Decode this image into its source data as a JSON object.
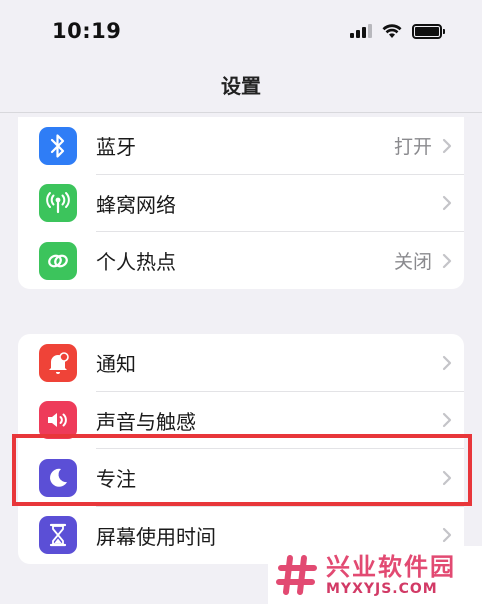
{
  "status_bar": {
    "time": "10:19"
  },
  "nav": {
    "title": "设置"
  },
  "groups": [
    {
      "items": [
        {
          "label": "蓝牙",
          "value": "打开",
          "icon": "bluetooth-icon",
          "color": "#2f7df6"
        },
        {
          "label": "蜂窝网络",
          "value": "",
          "icon": "cellular-icon",
          "color": "#3cc45c"
        },
        {
          "label": "个人热点",
          "value": "关闭",
          "icon": "hotspot-icon",
          "color": "#3cc45c"
        }
      ]
    },
    {
      "items": [
        {
          "label": "通知",
          "value": "",
          "icon": "notification-bell-icon",
          "color": "#ef4338"
        },
        {
          "label": "声音与触感",
          "value": "",
          "icon": "speaker-icon",
          "color": "#ee3b5a"
        },
        {
          "label": "专注",
          "value": "",
          "icon": "moon-icon",
          "color": "#5b4fd6"
        },
        {
          "label": "屏幕使用时间",
          "value": "",
          "icon": "hourglass-icon",
          "color": "#5b4fd6"
        }
      ]
    }
  ],
  "highlight": {
    "target": "专注",
    "color": "#e8363a"
  },
  "watermark": {
    "cn": "兴业软件园",
    "en": "MYXYJS.COM"
  }
}
